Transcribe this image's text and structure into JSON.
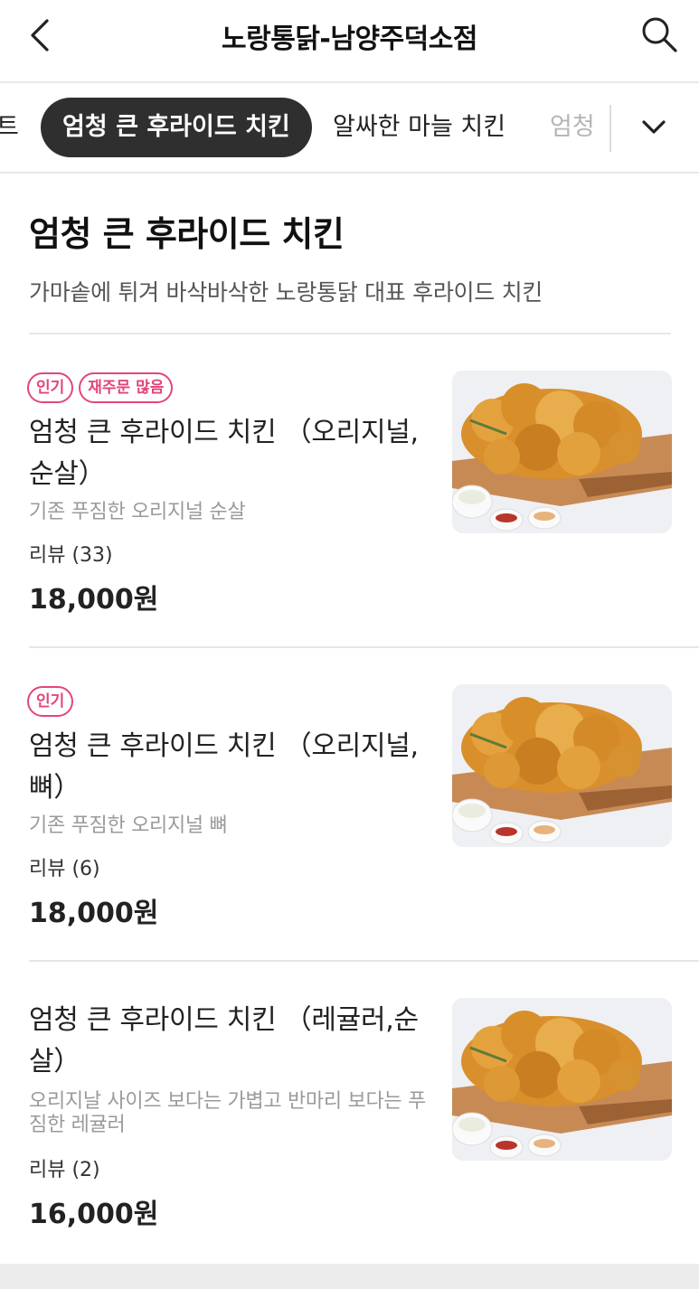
{
  "header": {
    "title": "노랑통닭-남양주덕소점",
    "back_icon": "chevron-left-icon",
    "search_icon": "search-icon"
  },
  "tabs": [
    {
      "label": "트",
      "active": false
    },
    {
      "label": "엄청 큰 후라이드 치킨",
      "active": true
    },
    {
      "label": "알싸한 마늘 치킨",
      "active": false
    },
    {
      "label": "엄청",
      "active": false
    }
  ],
  "tab_expand_icon": "chevron-down-icon",
  "section": {
    "title": "엄청 큰 후라이드 치킨",
    "description": "가마솥에 튀겨 바삭바삭한 노랑통닭 대표 후라이드 치킨"
  },
  "items": [
    {
      "badges": [
        "인기",
        "재주문 많음"
      ],
      "name": "엄청 큰 후라이드 치킨 （오리지널,순살）",
      "description": "기존 푸짐한 오리지널 순살",
      "review": "리뷰 (33)",
      "price": "18,000원",
      "image_icon": "fried-chicken-image"
    },
    {
      "badges": [
        "인기"
      ],
      "name": "엄청 큰 후라이드 치킨 （오리지널,뼈）",
      "description": "기존 푸짐한 오리지널 뼈",
      "review": "리뷰 (6)",
      "price": "18,000원",
      "image_icon": "fried-chicken-image"
    },
    {
      "badges": [],
      "name": "엄청 큰 후라이드 치킨 （레귤러,순살）",
      "description": "오리지날 사이즈 보다는 가볍고 반마리 보다는 푸짐한 레귤러",
      "review": "리뷰 (2)",
      "price": "16,000원",
      "image_icon": "fried-chicken-image"
    }
  ],
  "colors": {
    "badge": "#e3457b",
    "active_tab_bg": "#2f2f2f",
    "divider": "#e6e6e6"
  }
}
